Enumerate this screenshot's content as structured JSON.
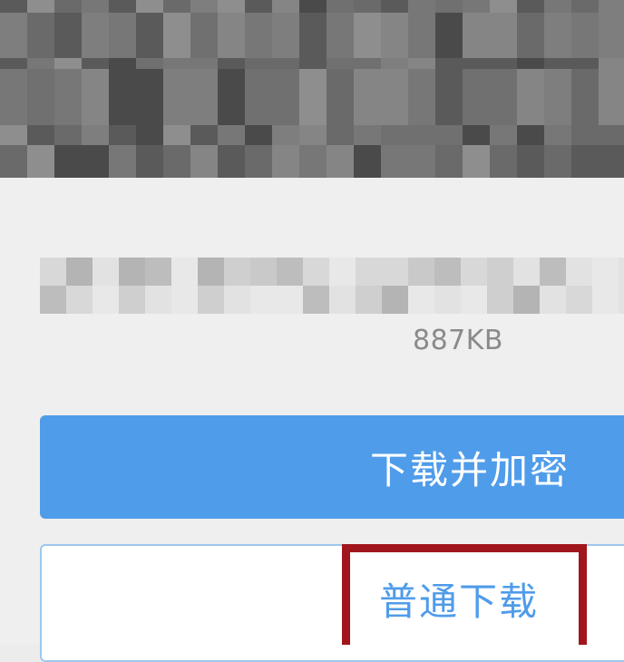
{
  "file": {
    "size": "887KB"
  },
  "actions": {
    "download_encrypt_label": "下载并加密",
    "normal_download_label": "普通下载"
  },
  "colors": {
    "primary": "#4f9cea",
    "annotation": "#a1161c",
    "sheet_background": "#efefef",
    "overlay_background": "#7a7a7a"
  }
}
